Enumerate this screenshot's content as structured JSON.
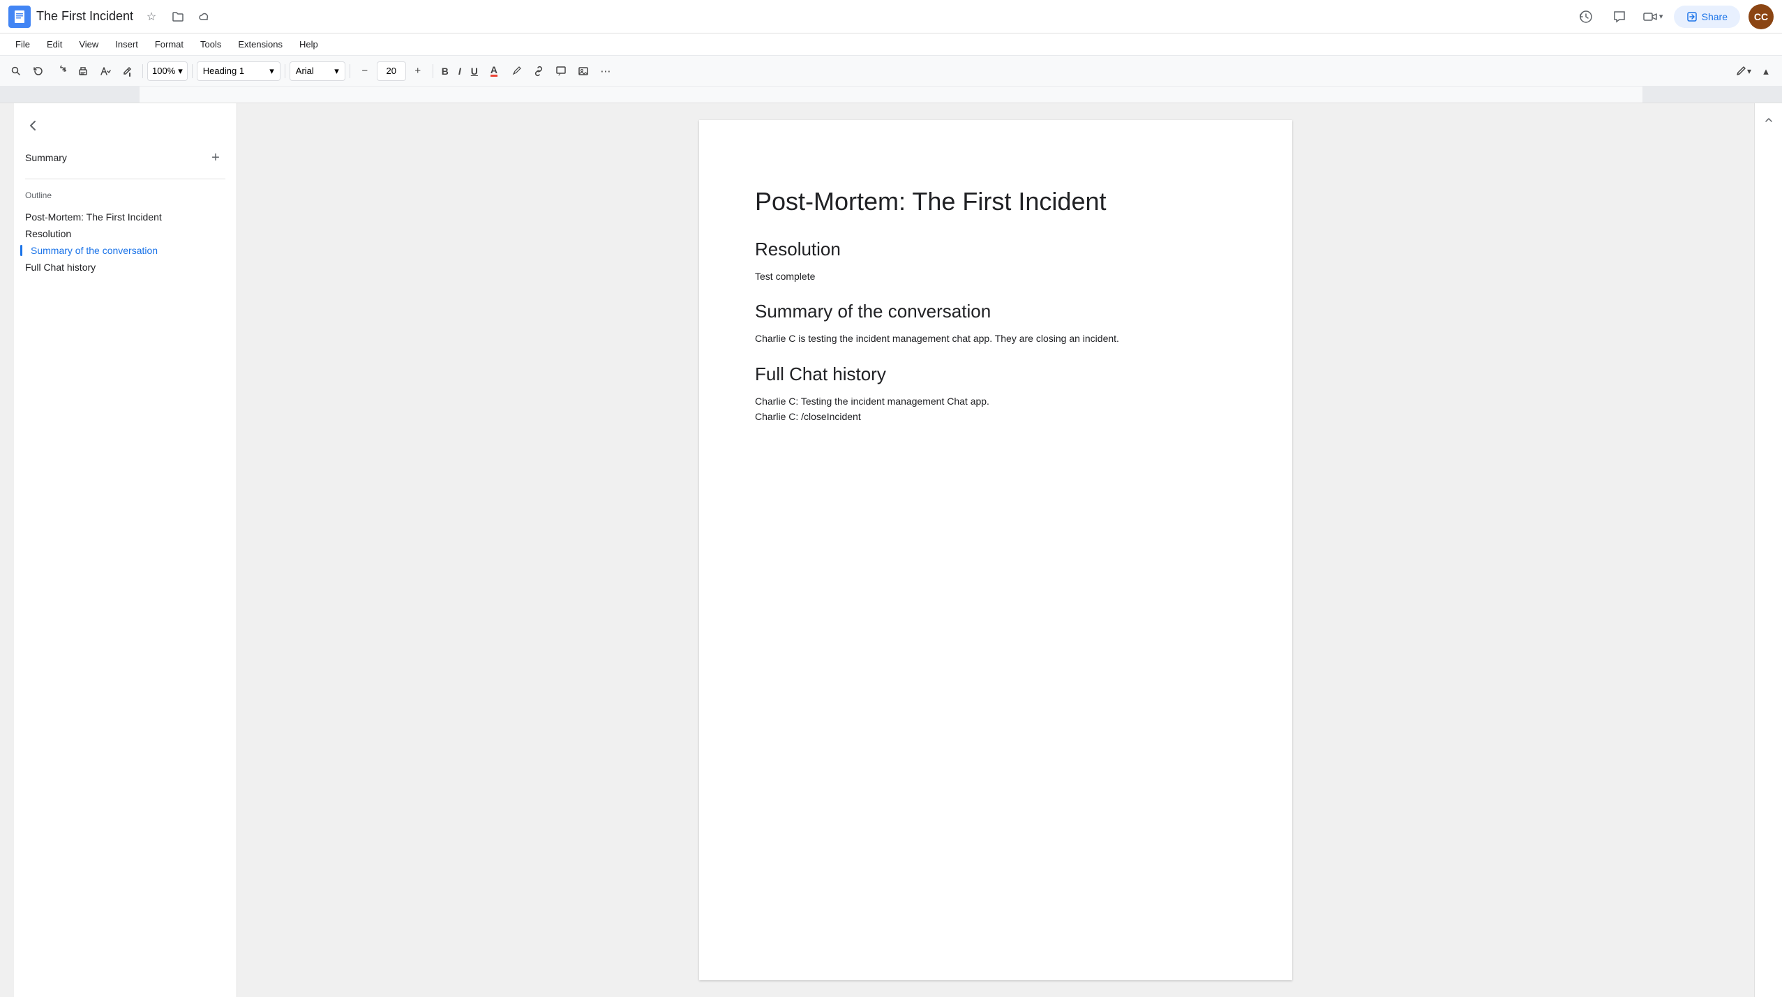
{
  "title_bar": {
    "doc_icon": "📄",
    "doc_title": "The First Incident",
    "star_icon": "☆",
    "folder_icon": "📁",
    "cloud_icon": "☁",
    "share_label": "Share",
    "share_icon": "🔒",
    "history_icon": "🕐",
    "comment_icon": "💬",
    "video_icon": "📹"
  },
  "menu_bar": {
    "items": [
      "File",
      "Edit",
      "View",
      "Insert",
      "Format",
      "Tools",
      "Extensions",
      "Help"
    ]
  },
  "toolbar": {
    "zoom_value": "100%",
    "style_selector": "Heading 1",
    "font_selector": "Arial",
    "font_size": "20",
    "bold": "B",
    "italic": "I",
    "underline": "U"
  },
  "sidebar": {
    "summary_label": "Summary",
    "outline_label": "Outline",
    "outline_items": [
      {
        "label": "Post-Mortem: The First Incident",
        "active": false
      },
      {
        "label": "Resolution",
        "active": false
      },
      {
        "label": "Summary of the conversation",
        "active": true
      },
      {
        "label": "Full Chat history",
        "active": false
      }
    ]
  },
  "document": {
    "main_title": "Post-Mortem: The First Incident",
    "sections": [
      {
        "heading": "Resolution",
        "body": "Test complete"
      },
      {
        "heading": "Summary of the conversation",
        "body": "Charlie C is testing the incident management chat app. They are closing an incident."
      },
      {
        "heading": "Full Chat history",
        "lines": [
          "Charlie C: Testing the incident management Chat app.",
          "Charlie C: /closeIncident"
        ]
      }
    ]
  }
}
